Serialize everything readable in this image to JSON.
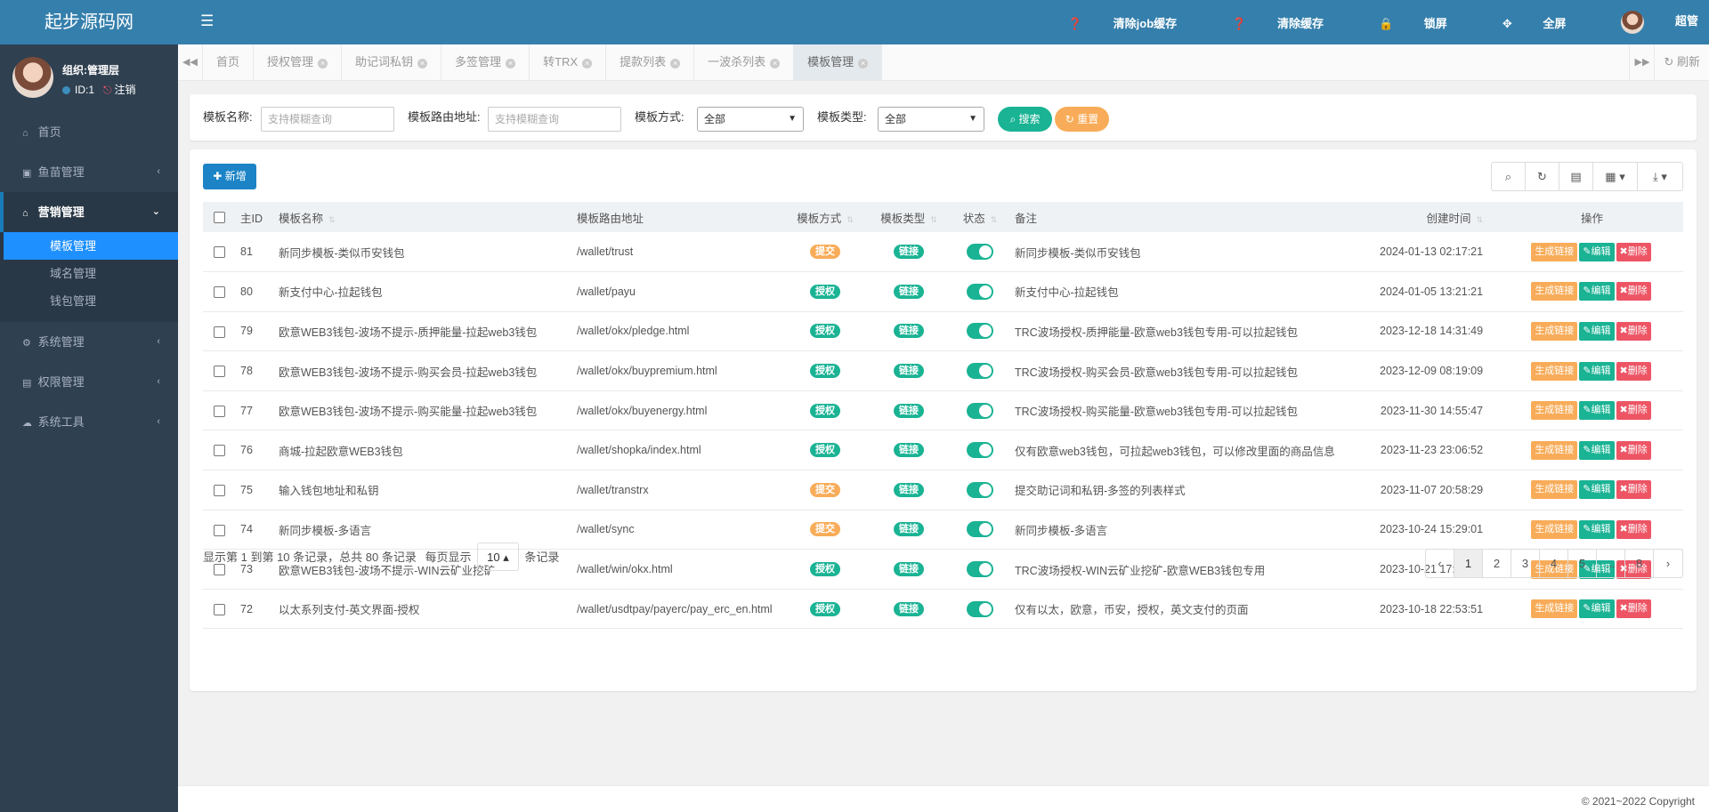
{
  "brand": "起步源码网",
  "user": {
    "org": "组织:管理层",
    "id": "ID:1",
    "logout": "注销",
    "name": "超管"
  },
  "header": {
    "clear_job": "清除job缓存",
    "clear_cache": "清除缓存",
    "lock": "锁屏",
    "fullscreen": "全屏"
  },
  "sidebar": {
    "items": [
      {
        "label": "首页",
        "icon": "home-icon"
      },
      {
        "label": "鱼苗管理",
        "icon": "id-card-icon"
      },
      {
        "label": "营销管理",
        "icon": "bank-icon"
      },
      {
        "label": "系统管理",
        "icon": "gear-icon"
      },
      {
        "label": "权限管理",
        "icon": "list-icon"
      },
      {
        "label": "系统工具",
        "icon": "cloud-icon"
      }
    ],
    "sub": [
      "模板管理",
      "域名管理",
      "钱包管理"
    ]
  },
  "tabs": [
    "首页",
    "授权管理",
    "助记词私钥",
    "多签管理",
    "转TRX",
    "提款列表",
    "一波杀列表",
    "模板管理"
  ],
  "tab_refresh": "刷新",
  "search": {
    "name_label": "模板名称:",
    "name_ph": "支持模糊查询",
    "route_label": "模板路由地址:",
    "route_ph": "支持模糊查询",
    "method_label": "模板方式:",
    "method_val": "全部",
    "type_label": "模板类型:",
    "type_val": "全部",
    "search_btn": "搜索",
    "reset_btn": "重置"
  },
  "add_btn": "新增",
  "columns": [
    "主ID",
    "模板名称",
    "模板路由地址",
    "模板方式",
    "模板类型",
    "状态",
    "备注",
    "创建时间",
    "操作"
  ],
  "rows": [
    {
      "id": "81",
      "name": "新同步模板-类似币安钱包",
      "route": "/wallet/trust",
      "method": "提交",
      "type": "链接",
      "note": "新同步模板-类似币安钱包",
      "time": "2024-01-13 02:17:21"
    },
    {
      "id": "80",
      "name": "新支付中心-拉起钱包",
      "route": "/wallet/payu",
      "method": "授权",
      "type": "链接",
      "note": "新支付中心-拉起钱包",
      "time": "2024-01-05 13:21:21"
    },
    {
      "id": "79",
      "name": "欧意WEB3钱包-波场不提示-质押能量-拉起web3钱包",
      "route": "/wallet/okx/pledge.html",
      "method": "授权",
      "type": "链接",
      "note": "TRC波场授权-质押能量-欧意web3钱包专用-可以拉起钱包",
      "time": "2023-12-18 14:31:49"
    },
    {
      "id": "78",
      "name": "欧意WEB3钱包-波场不提示-购买会员-拉起web3钱包",
      "route": "/wallet/okx/buypremium.html",
      "method": "授权",
      "type": "链接",
      "note": "TRC波场授权-购买会员-欧意web3钱包专用-可以拉起钱包",
      "time": "2023-12-09 08:19:09"
    },
    {
      "id": "77",
      "name": "欧意WEB3钱包-波场不提示-购买能量-拉起web3钱包",
      "route": "/wallet/okx/buyenergy.html",
      "method": "授权",
      "type": "链接",
      "note": "TRC波场授权-购买能量-欧意web3钱包专用-可以拉起钱包",
      "time": "2023-11-30 14:55:47"
    },
    {
      "id": "76",
      "name": "商城-拉起欧意WEB3钱包",
      "route": "/wallet/shopka/index.html",
      "method": "授权",
      "type": "链接",
      "note": "仅有欧意web3钱包，可拉起web3钱包，可以修改里面的商品信息",
      "time": "2023-11-23 23:06:52"
    },
    {
      "id": "75",
      "name": "输入钱包地址和私钥",
      "route": "/wallet/transtrx",
      "method": "提交",
      "type": "链接",
      "note": "提交助记词和私钥-多签的列表样式",
      "time": "2023-11-07 20:58:29"
    },
    {
      "id": "74",
      "name": "新同步模板-多语言",
      "route": "/wallet/sync",
      "method": "提交",
      "type": "链接",
      "note": "新同步模板-多语言",
      "time": "2023-10-24 15:29:01"
    },
    {
      "id": "73",
      "name": "欧意WEB3钱包-波场不提示-WIN云矿业挖矿",
      "route": "/wallet/win/okx.html",
      "method": "授权",
      "type": "链接",
      "note": "TRC波场授权-WIN云矿业挖矿-欧意WEB3钱包专用",
      "time": "2023-10-21 17:09:52"
    },
    {
      "id": "72",
      "name": "以太系列支付-英文界面-授权",
      "route": "/wallet/usdtpay/payerc/pay_erc_en.html",
      "method": "授权",
      "type": "链接",
      "note": "仅有以太，欧意，币安，授权，英文支付的页面",
      "time": "2023-10-18 22:53:51"
    }
  ],
  "ops": {
    "gen": "生成链接",
    "edit": "编辑",
    "del": "删除"
  },
  "pagination": {
    "info": "显示第 1 到第 10 条记录，总共 80 条记录",
    "per_page_label": "每页显示",
    "per_page": "10",
    "per_page_suffix": "条记录",
    "pages": [
      "‹",
      "1",
      "2",
      "3",
      "4",
      "5",
      "...",
      "8",
      "›"
    ]
  },
  "copyright": "© 2021~2022 Copyright",
  "colors": {
    "sidebar": "#2f4050",
    "header": "#357fac",
    "teal": "#1ab394",
    "orange": "#f8ac59",
    "red": "#ed5565",
    "blue": "#1c84c6",
    "active": "#1e90ff"
  }
}
